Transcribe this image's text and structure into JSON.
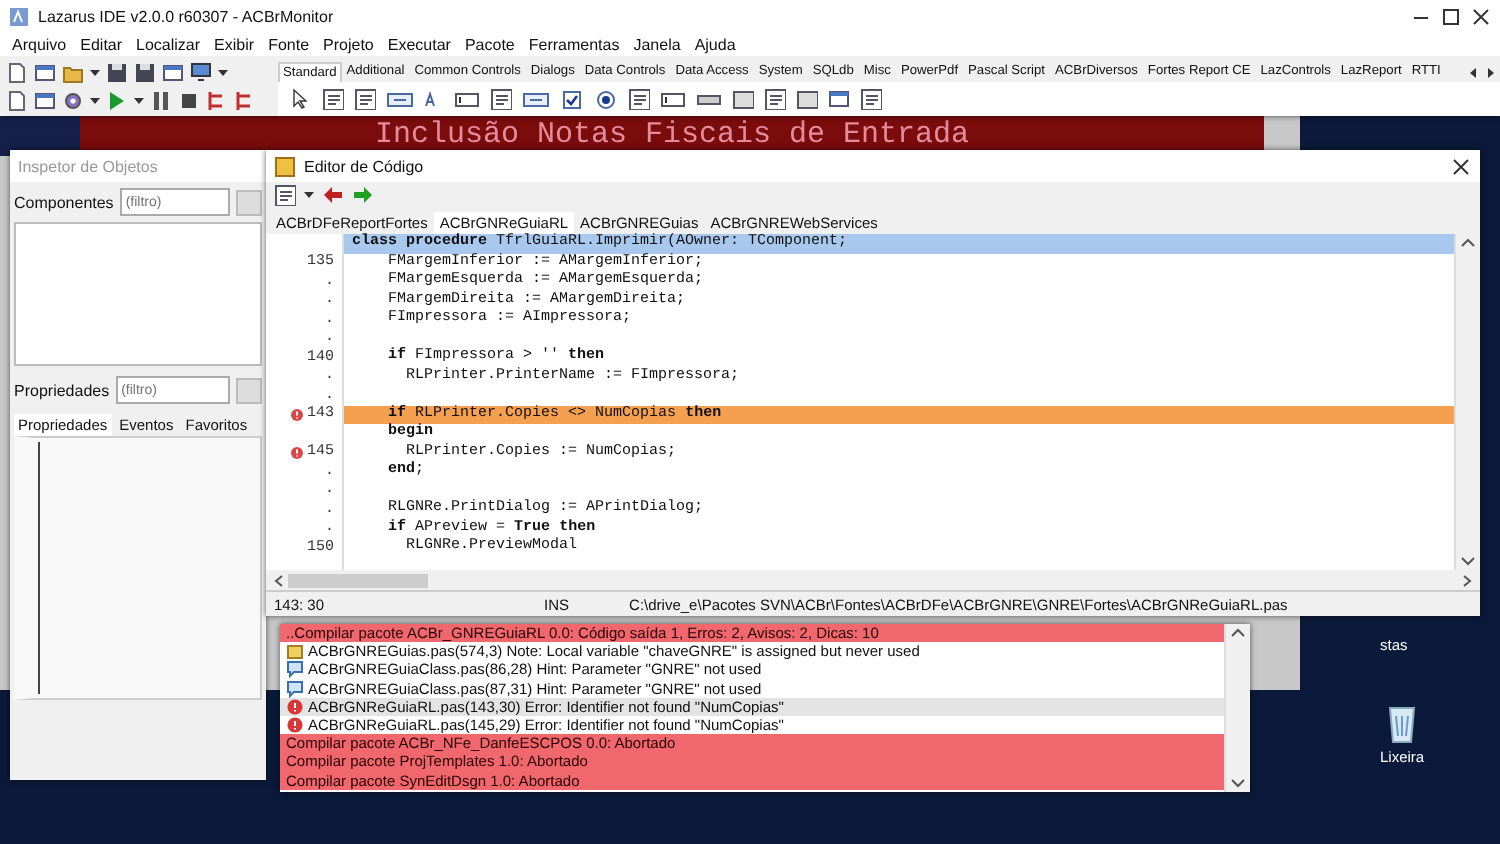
{
  "ide": {
    "title": "Lazarus IDE v2.0.0 r60307 - ACBrMonitor",
    "menu": [
      "Arquivo",
      "Editar",
      "Localizar",
      "Exibir",
      "Fonte",
      "Projeto",
      "Executar",
      "Pacote",
      "Ferramentas",
      "Janela",
      "Ajuda"
    ],
    "palette_tabs": [
      {
        "label": "Standard",
        "selected": true
      },
      {
        "label": "Additional",
        "selected": false
      },
      {
        "label": "Common Controls",
        "selected": false
      },
      {
        "label": "Dialogs",
        "selected": false
      },
      {
        "label": "Data Controls",
        "selected": false
      },
      {
        "label": "Data Access",
        "selected": false
      },
      {
        "label": "System",
        "selected": false
      },
      {
        "label": "SQLdb",
        "selected": false
      },
      {
        "label": "Misc",
        "selected": false
      },
      {
        "label": "PowerPdf",
        "selected": false
      },
      {
        "label": "Pascal Script",
        "selected": false
      },
      {
        "label": "ACBrDiversos",
        "selected": false
      },
      {
        "label": "Fortes Report CE",
        "selected": false
      },
      {
        "label": "LazControls",
        "selected": false
      },
      {
        "label": "LazReport",
        "selected": false
      },
      {
        "label": "RTTI",
        "selected": false
      }
    ]
  },
  "background_app": {
    "banner": "Inclusão Notas Fiscais de Entrada"
  },
  "object_inspector": {
    "title": "Inspetor de Objetos",
    "components_label": "Componentes",
    "components_filter": {
      "placeholder": "(filtro)"
    },
    "properties_label": "Propriedades",
    "properties_filter": {
      "placeholder": "(filtro)"
    },
    "tabs": [
      {
        "label": "Propriedades",
        "selected": true
      },
      {
        "label": "Eventos",
        "selected": false
      },
      {
        "label": "Favoritos",
        "selected": false
      }
    ]
  },
  "code_editor": {
    "title": "Editor de Código",
    "tabs": [
      {
        "label": "ACBrDFeReportFortes",
        "selected": false
      },
      {
        "label": "ACBrGNReGuiaRL",
        "selected": true
      },
      {
        "label": "ACBrGNREGuias",
        "selected": false
      },
      {
        "label": "ACBrGNREWebServices",
        "selected": false
      }
    ],
    "lines": [
      {
        "text": "**class procedure** TfrlGuiaRL.Imprimir(AOwner: TComponent;",
        "kind": "header",
        "error": false
      },
      {
        "number": "135",
        "text": "    FMargemInferior := AMargemInferior;",
        "kind": "plain",
        "error": false
      },
      {
        "number": ".",
        "text": "    FMargemEsquerda := AMargemEsquerda;",
        "kind": "plain",
        "error": false
      },
      {
        "number": ".",
        "text": "    FMargemDireita := AMargemDireita;",
        "kind": "plain",
        "error": false
      },
      {
        "number": ".",
        "text": "    FImpressora := AImpressora;",
        "kind": "plain",
        "error": false
      },
      {
        "number": ".",
        "kind": "plain",
        "error": false
      },
      {
        "number": "140",
        "text": "    **if** FImpressora > '' **then**",
        "kind": "plain",
        "error": false
      },
      {
        "number": ".",
        "text": "      RLPrinter.PrinterName := FImpressora;",
        "kind": "plain",
        "error": false
      },
      {
        "number": ".",
        "kind": "plain",
        "error": false
      },
      {
        "number": "143",
        "text": "    **if** RLPrinter.Copies <> NumCopias **then**",
        "kind": "error",
        "error": true
      },
      {
        "text": "    **begin**",
        "kind": "plain",
        "error": false
      },
      {
        "number": "145",
        "text": "      RLPrinter.Copies := NumCopias;",
        "kind": "plain",
        "error": true
      },
      {
        "number": ".",
        "text": "    **end**;",
        "kind": "plain",
        "error": false
      },
      {
        "number": ".",
        "kind": "plain",
        "error": false
      },
      {
        "number": ".",
        "text": "    RLGNRe.PrintDialog := APrintDialog;",
        "kind": "plain",
        "error": false
      },
      {
        "number": ".",
        "text": "    **if** APreview = **True** **then**",
        "kind": "plain",
        "error": false
      },
      {
        "number": "150",
        "text": "      RLGNRe.PreviewModal",
        "kind": "plain",
        "error": false
      }
    ],
    "status": {
      "position": "143: 30",
      "mode": "INS",
      "file": "C:\\drive_e\\Pacotes SVN\\ACBr\\Fontes\\ACBrDFe\\ACBrGNRE\\GNRE\\Fortes\\ACBrGNReGuiaRL.pas"
    }
  },
  "messages": [
    {
      "kind": "summary",
      "text": "..Compilar pacote ACBr_GNREGuiaRL 0.0: Código saída 1, Erros: 2, Avisos: 2, Dicas: 10",
      "selected": false
    },
    {
      "kind": "note",
      "text": "ACBrGNREGuias.pas(574,3) Note: Local variable \"chaveGNRE\" is assigned but never used",
      "selected": false
    },
    {
      "kind": "hint",
      "text": "ACBrGNREGuiaClass.pas(86,28) Hint: Parameter \"GNRE\" not used",
      "selected": false
    },
    {
      "kind": "hint",
      "text": "ACBrGNREGuiaClass.pas(87,31) Hint: Parameter \"GNRE\" not used",
      "selected": false
    },
    {
      "kind": "error",
      "text": "ACBrGNReGuiaRL.pas(143,30) Error: Identifier not found \"NumCopias\"",
      "selected": true
    },
    {
      "kind": "error",
      "text": "ACBrGNReGuiaRL.pas(145,29) Error: Identifier not found \"NumCopias\"",
      "selected": false
    },
    {
      "kind": "abort",
      "text": "Compilar pacote ACBr_NFe_DanfeESCPOS 0.0: Abortado",
      "selected": false
    },
    {
      "kind": "abort",
      "text": "Compilar pacote ProjTemplates 1.0: Abortado",
      "selected": false
    },
    {
      "kind": "abort",
      "text": "Compilar pacote SynEditDsgn 1.0: Abortado",
      "selected": false
    }
  ],
  "desktop_icons": [
    {
      "label": "stas"
    },
    {
      "label": "Lixeira"
    }
  ]
}
